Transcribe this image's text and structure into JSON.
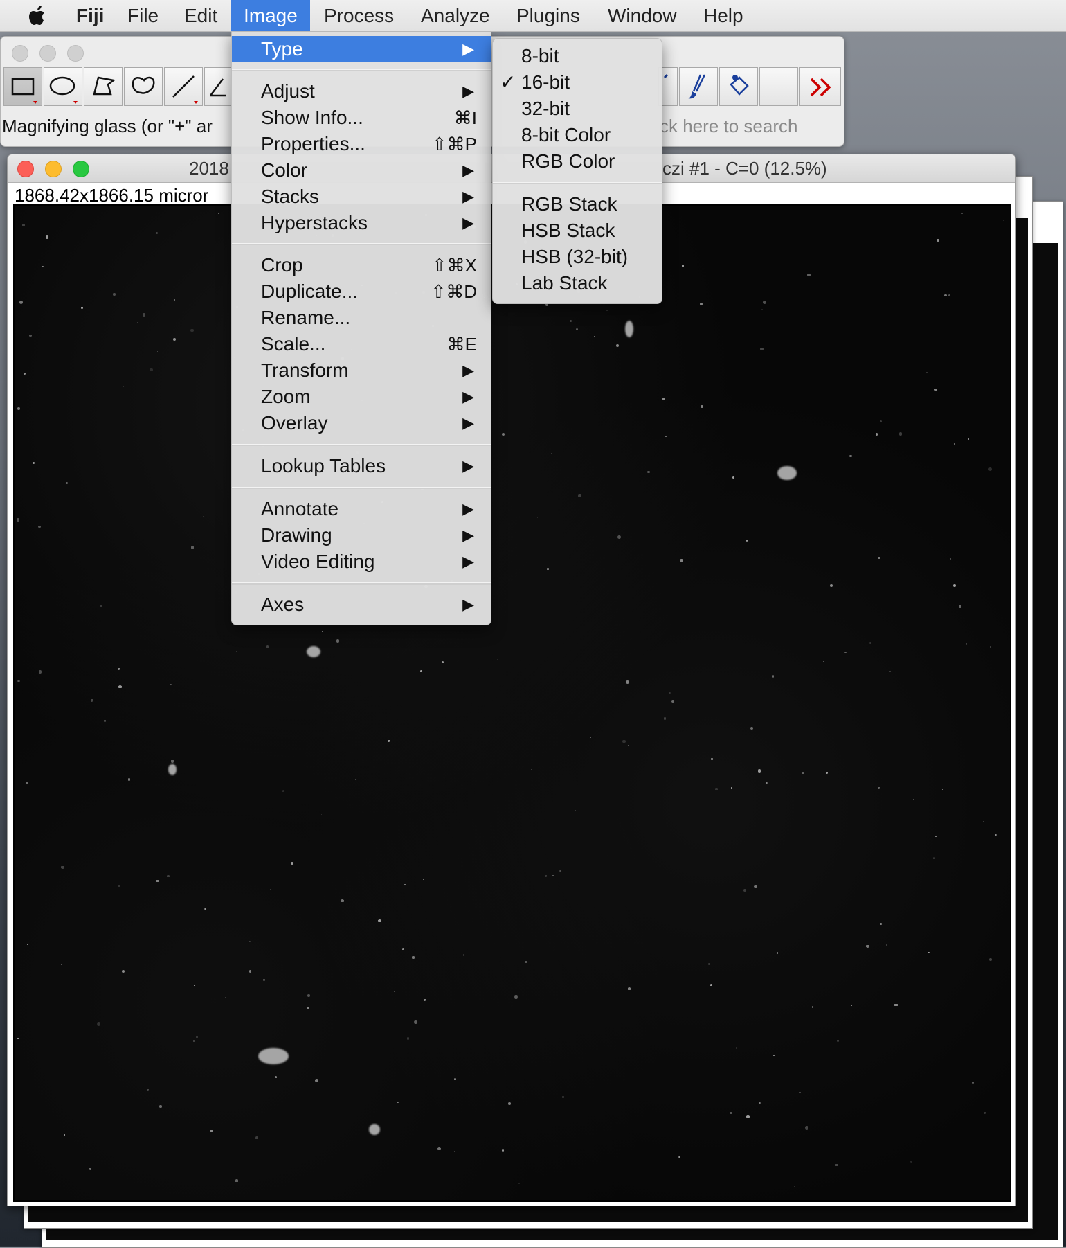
{
  "menubar": {
    "app": "Fiji",
    "items": [
      "File",
      "Edit",
      "Image",
      "Process",
      "Analyze",
      "Plugins",
      "Window",
      "Help"
    ],
    "active": "Image"
  },
  "toolbar": {
    "status_text": "Magnifying glass (or \"+\" ar",
    "search_hint": "ck here to search",
    "tools": [
      "rectangle-tool",
      "oval-tool",
      "polygon-tool",
      "freehand-tool",
      "line-tool",
      "angle-tool",
      "brush-tool",
      "flood-fill-tool",
      "more-tools"
    ]
  },
  "image_window": {
    "title_left": "2018",
    "title_right": "czi #1 - C=0 (12.5%)",
    "info": "1868.42x1866.15 micror"
  },
  "image_menu": {
    "items": [
      {
        "label": "Type",
        "shortcut": "",
        "submenu": true
      },
      {
        "label": "Adjust",
        "shortcut": "",
        "submenu": true
      },
      {
        "label": "Show Info...",
        "shortcut": "⌘I",
        "submenu": false
      },
      {
        "label": "Properties...",
        "shortcut": "⇧⌘P",
        "submenu": false
      },
      {
        "label": "Color",
        "shortcut": "",
        "submenu": true
      },
      {
        "label": "Stacks",
        "shortcut": "",
        "submenu": true
      },
      {
        "label": "Hyperstacks",
        "shortcut": "",
        "submenu": true
      },
      {
        "label": "Crop",
        "shortcut": "⇧⌘X",
        "submenu": false
      },
      {
        "label": "Duplicate...",
        "shortcut": "⇧⌘D",
        "submenu": false
      },
      {
        "label": "Rename...",
        "shortcut": "",
        "submenu": false
      },
      {
        "label": "Scale...",
        "shortcut": "⌘E",
        "submenu": false
      },
      {
        "label": "Transform",
        "shortcut": "",
        "submenu": true
      },
      {
        "label": "Zoom",
        "shortcut": "",
        "submenu": true
      },
      {
        "label": "Overlay",
        "shortcut": "",
        "submenu": true
      },
      {
        "label": "Lookup Tables",
        "shortcut": "",
        "submenu": true
      },
      {
        "label": "Annotate",
        "shortcut": "",
        "submenu": true
      },
      {
        "label": "Drawing",
        "shortcut": "",
        "submenu": true
      },
      {
        "label": "Video Editing",
        "shortcut": "",
        "submenu": true
      },
      {
        "label": "Axes",
        "shortcut": "",
        "submenu": true
      }
    ],
    "highlighted": "Type"
  },
  "type_menu": {
    "items": [
      {
        "label": "8-bit",
        "checked": false
      },
      {
        "label": "16-bit",
        "checked": true
      },
      {
        "label": "32-bit",
        "checked": false
      },
      {
        "label": "8-bit Color",
        "checked": false
      },
      {
        "label": "RGB Color",
        "checked": false
      },
      {
        "label": "RGB Stack",
        "checked": false
      },
      {
        "label": "HSB Stack",
        "checked": false
      },
      {
        "label": "HSB (32-bit)",
        "checked": false
      },
      {
        "label": "Lab Stack",
        "checked": false
      }
    ],
    "check_glyph": "✓"
  },
  "arrow_glyph": "▶"
}
